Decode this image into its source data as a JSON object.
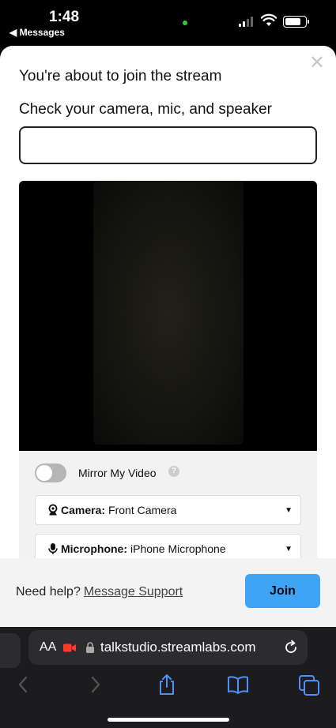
{
  "status_bar": {
    "time": "1:48",
    "back_app": "◀ Messages"
  },
  "dialog": {
    "title": "You're about to join the stream",
    "subtitle": "Check your camera, mic, and speaker",
    "name_input": {
      "value": "",
      "placeholder": ""
    },
    "mirror": {
      "label": "Mirror My Video",
      "enabled": false,
      "help": "?"
    },
    "camera": {
      "label": "Camera:",
      "value": "Front Camera"
    },
    "microphone": {
      "label": "Microphone:",
      "value": "iPhone Microphone"
    },
    "footer": {
      "help_text": "Need help?",
      "support_link": "Message Support",
      "join_label": "Join"
    }
  },
  "browser": {
    "aa_label": "AA",
    "url": "talkstudio.streamlabs.com"
  },
  "colors": {
    "join_button": "#3fa4f6",
    "camera_indicator": "#ff3b30",
    "safari_accent": "#4f8ff7"
  }
}
